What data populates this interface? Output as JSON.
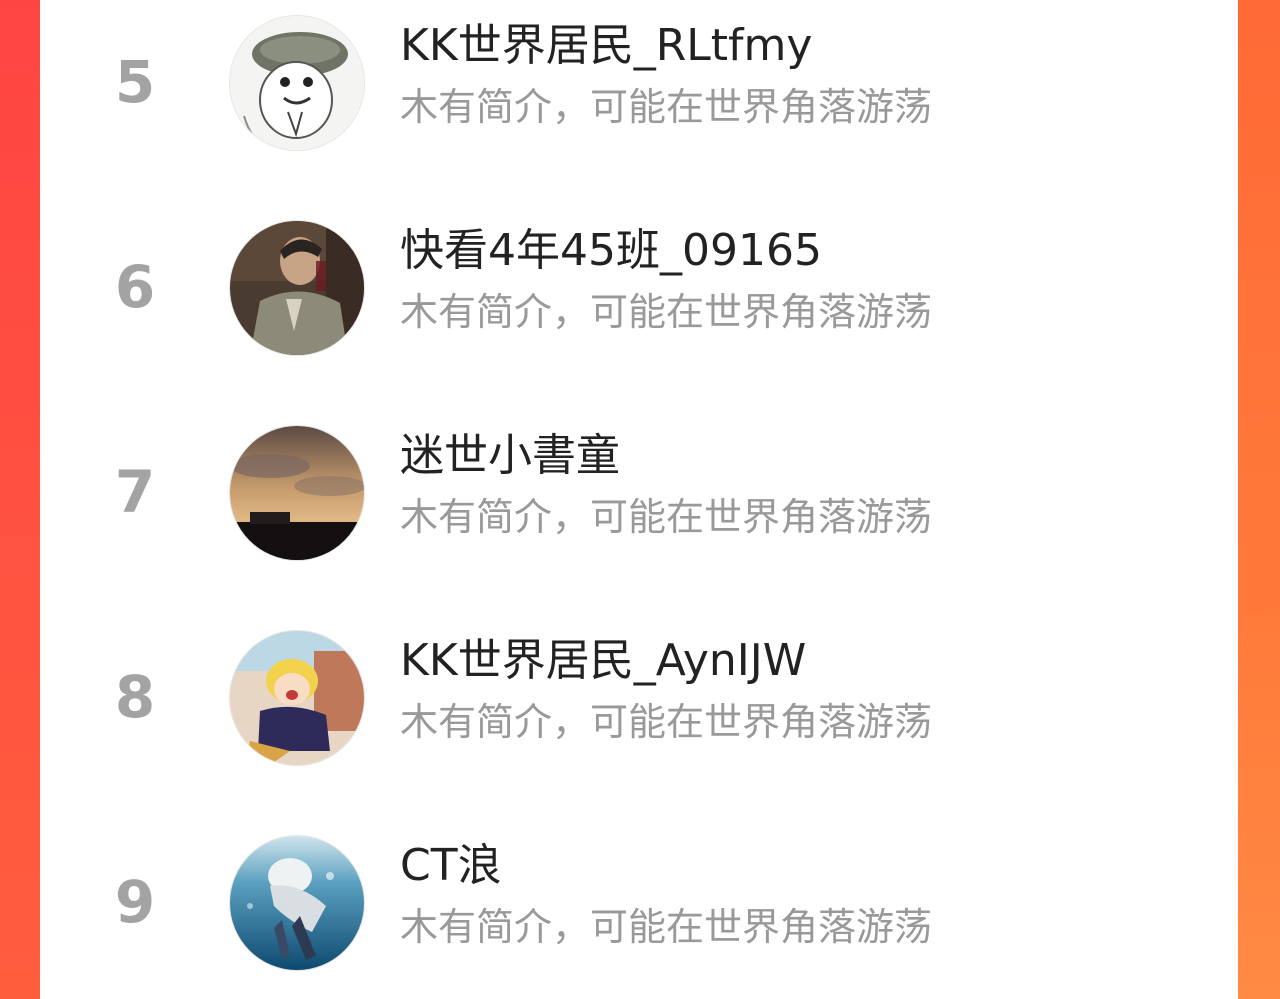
{
  "theme": {
    "accent_left": "#ff4a3e",
    "accent_right": "#ff7a3a",
    "rank_color": "#a3a3a3",
    "name_color": "#222222",
    "bio_color": "#999999"
  },
  "list": {
    "items": [
      {
        "rank": "5",
        "name": "KK世界居民_RLtfmy",
        "bio": "木有简介，可能在世界角落游荡",
        "avatar": "cartoon-face-avatar"
      },
      {
        "rank": "6",
        "name": "快看4年45班_09165",
        "bio": "木有简介，可能在世界角落游荡",
        "avatar": "man-with-wine-avatar"
      },
      {
        "rank": "7",
        "name": "迷世小書童",
        "bio": "木有简介，可能在世界角落游荡",
        "avatar": "sunset-sky-avatar"
      },
      {
        "rank": "8",
        "name": "KK世界居民_AynIJW",
        "bio": "木有简介，可能在世界角落游荡",
        "avatar": "anime-girl-avatar"
      },
      {
        "rank": "9",
        "name": "CT浪",
        "bio": "木有简介，可能在世界角落游荡",
        "avatar": "underwater-figure-avatar"
      }
    ]
  }
}
